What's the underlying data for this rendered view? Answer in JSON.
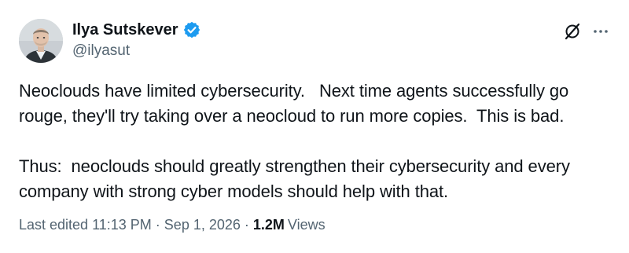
{
  "author": {
    "display_name": "Ilya Sutskever",
    "handle": "@ilyasut",
    "verified": true
  },
  "tweet": {
    "paragraphs": [
      "Neoclouds have limited cybersecurity.   Next time agents successfully go rouge, they'll try taking over a neocloud to run more copies.  This is bad.",
      "Thus:  neoclouds should greatly strengthen their cybersecurity and every company with strong cyber models should help with that."
    ]
  },
  "meta": {
    "edited_label": "Last edited",
    "time": "11:13 PM",
    "separator": "·",
    "date": "Sep 1, 2026",
    "views_count": "1.2M",
    "views_label": "Views"
  },
  "icons": {
    "verified": "verified-badge-icon",
    "grok": "grok-icon",
    "more": "more-horizontal-icon"
  },
  "colors": {
    "text_primary": "#0f1419",
    "text_secondary": "#536471",
    "verified_blue": "#1d9bf0"
  }
}
